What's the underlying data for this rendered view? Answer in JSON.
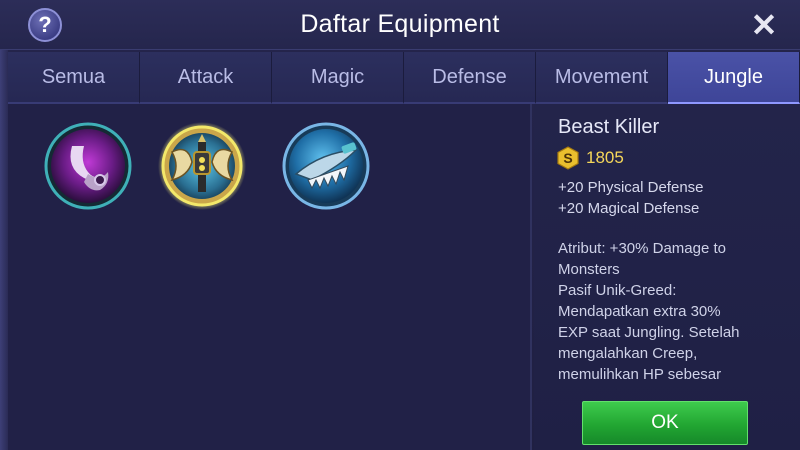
{
  "header": {
    "help_label": "?",
    "title": "Daftar Equipment",
    "close_label": "✕"
  },
  "tabs": [
    {
      "label": "Semua",
      "active": false
    },
    {
      "label": "Attack",
      "active": false
    },
    {
      "label": "Magic",
      "active": false
    },
    {
      "label": "Defense",
      "active": false
    },
    {
      "label": "Movement",
      "active": false
    },
    {
      "label": "Jungle",
      "active": true
    }
  ],
  "items": [
    {
      "icon": "purple-hook-blade-icon",
      "selected": false
    },
    {
      "icon": "beast-killer-axe-icon",
      "selected": true
    },
    {
      "icon": "blue-serrated-blade-icon",
      "selected": false
    }
  ],
  "detail": {
    "name": "Beast Killer",
    "coin_icon": "gold-coin-icon",
    "coin_label": "S",
    "price": "1805",
    "stats": [
      "+20 Physical Defense",
      "+20 Magical Defense"
    ],
    "description": [
      "Atribut: +30% Damage to",
      "Monsters",
      "Pasif Unik-Greed:",
      "Mendapatkan extra 30%",
      "EXP saat Jungling. Setelah",
      "mengalahkan Creep,",
      "memulihkan HP sebesar"
    ]
  },
  "ok_button": {
    "label": "OK"
  },
  "colors": {
    "active_tab": "#4a52a7",
    "price": "#f5d75a",
    "ok_button": "#22a632",
    "selected_ring": "#f3e86a"
  }
}
